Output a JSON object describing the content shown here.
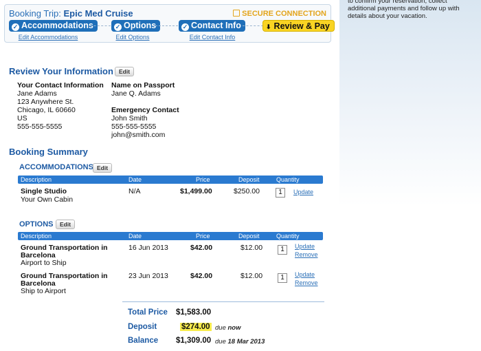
{
  "sidebar": {
    "text": "to confirm your reservation, collect additional payments and follow up with details about your vacation."
  },
  "progress": {
    "title_prefix": "Booking Trip: ",
    "title_name": "Epic Med Cruise",
    "secure": "SECURE CONNECTION",
    "steps": [
      {
        "label": "Accommodations",
        "edit": "Edit Accommodations"
      },
      {
        "label": "Options",
        "edit": "Edit Options"
      },
      {
        "label": "Contact Info",
        "edit": "Edit Contact Info"
      },
      {
        "label": "Review & Pay"
      }
    ]
  },
  "review": {
    "heading": "Review Your Information",
    "edit_label": "Edit",
    "contact": {
      "label": "Your Contact Information",
      "name": "Jane Adams",
      "street": "123 Anywhere St.",
      "city": "Chicago, IL 60660",
      "country": "US",
      "phone": "555-555-5555"
    },
    "passport": {
      "label": "Name on Passport",
      "name": "Jane Q. Adams"
    },
    "emergency": {
      "label": "Emergency Contact",
      "name": "John Smith",
      "phone": "555-555-5555",
      "email": "john@smith.com"
    }
  },
  "summary": {
    "heading": "Booking Summary",
    "columns": [
      "Description",
      "Date",
      "Price",
      "Deposit",
      "Quantity"
    ],
    "accommodations": {
      "heading": "ACCOMMODATIONS",
      "edit_label": "Edit",
      "rows": [
        {
          "title": "Single Studio",
          "sub": "Your Own Cabin",
          "date": "N/A",
          "price": "$1,499.00",
          "deposit": "$250.00",
          "qty": "1",
          "update": "Update"
        }
      ]
    },
    "options": {
      "heading": "OPTIONS",
      "edit_label": "Edit",
      "rows": [
        {
          "title1": "Ground Transportation in",
          "title2": "Barcelona",
          "sub": "Airport to Ship",
          "date": "16 Jun 2013",
          "price": "$42.00",
          "deposit": "$12.00",
          "qty": "1",
          "update": "Update",
          "remove": "Remove"
        },
        {
          "title1": "Ground Transportation in",
          "title2": "Barcelona",
          "sub": "Ship to Airport",
          "date": "23 Jun 2013",
          "price": "$42.00",
          "deposit": "$12.00",
          "qty": "1",
          "update": "Update",
          "remove": "Remove"
        }
      ]
    },
    "totals": {
      "total_label": "Total Price",
      "total_value": "$1,583.00",
      "deposit_label": "Deposit",
      "deposit_value": "$274.00",
      "deposit_due_prefix": "due ",
      "deposit_due": "now",
      "balance_label": "Balance",
      "balance_value": "$1,309.00",
      "balance_due_prefix": "due ",
      "balance_due": "18 Mar 2013"
    }
  }
}
